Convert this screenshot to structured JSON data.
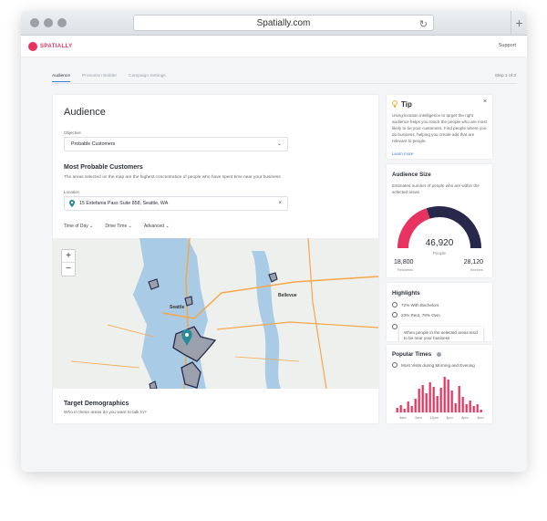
{
  "browser": {
    "url": "Spatially.com"
  },
  "app": {
    "logo_text": "SPATIALLY",
    "support": "Support"
  },
  "tabs": [
    {
      "label": "Audience"
    },
    {
      "label": "Promotion Builder"
    },
    {
      "label": "Campaign Settings"
    }
  ],
  "step": "Step 1 of 3",
  "audience": {
    "title": "Audience",
    "objective_label": "Objective",
    "objective_value": "Probable Customers",
    "mpc_title": "Most Probable Customers",
    "mpc_desc": "The areas selected on the map are the highest concentration of people who have spent time near your business",
    "location_label": "Location",
    "location_value": "15 Estefania Pass Suite 858, Seattle, WA",
    "filters": [
      "Time of Day ⌄",
      "Drive Time ⌄",
      "Advanced ⌄"
    ],
    "map_labels": {
      "seattle": "Seattle",
      "bellevue": "Bellevue"
    },
    "zoom_in": "+",
    "zoom_out": "−",
    "target_title": "Target Demographics",
    "target_desc": "Who in these areas do you want to talk to?"
  },
  "tip": {
    "title": "Tip",
    "text": "Using location intelligence to target the right audience helps you reach the people who are most likely to be your customers. Find people where you do business, helping you create ads that are relevant to people.",
    "link": "Learn more",
    "close": "×"
  },
  "audience_size": {
    "title": "Audience Size",
    "desc": "Estimated number of people who are within the selected areas.",
    "total": "46,920",
    "total_label": "People",
    "residents_value": "18,800",
    "residents_label": "Residents",
    "workers_value": "28,120",
    "workers_label": "Workers",
    "residents_fraction": 0.4,
    "colors": {
      "residents": "#e8325f",
      "workers": "#27284a"
    }
  },
  "highlights": {
    "title": "Highlights",
    "items": [
      "72% With Bachelors",
      "23% Rent, 78% Own"
    ],
    "tooltip": "When people in the selected areas tend to be near your business"
  },
  "popular_times": {
    "title": "Popular Times",
    "subtitle": "Most Visits during Morning and Evening",
    "x_labels": [
      "6am",
      "9am",
      "12pm",
      "3pm",
      "6pm",
      "9pm"
    ]
  },
  "chart_data": {
    "type": "bar",
    "title": "Popular Times",
    "categories": [
      "1",
      "2",
      "3",
      "4",
      "5",
      "6",
      "7",
      "8",
      "9",
      "10",
      "11",
      "12",
      "13",
      "14",
      "15",
      "16",
      "17",
      "18",
      "19",
      "20",
      "21",
      "22",
      "23",
      "24"
    ],
    "x_tick_labels": [
      "6am",
      "9am",
      "12pm",
      "3pm",
      "6pm",
      "9pm"
    ],
    "values": [
      5,
      8,
      4,
      12,
      7,
      15,
      26,
      30,
      21,
      33,
      28,
      18,
      27,
      39,
      36,
      24,
      10,
      29,
      17,
      9,
      13,
      7,
      9,
      3
    ],
    "color": "#e8325f"
  }
}
